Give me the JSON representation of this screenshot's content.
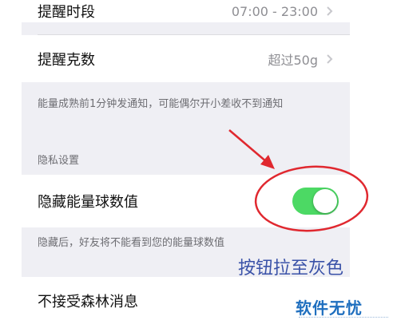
{
  "settings": {
    "remind_period": {
      "label": "提醒时段",
      "value": "07:00 - 23:00"
    },
    "remind_weight": {
      "label": "提醒克数",
      "value": "超过50g"
    },
    "remind_note": "能量成熟前1分钟发通知，可能偶尔开小差收不到通知",
    "privacy_section_title": "隐私设置",
    "hide_energy": {
      "label": "隐藏能量球数值",
      "enabled": true
    },
    "hide_note": "隐藏后，好友将不能看到您的能量球数值",
    "no_forest_msg": {
      "label": "不接受森林消息"
    }
  },
  "annotation": {
    "text": "按钮拉至灰色",
    "color": "#3a52a8",
    "mark_color": "#e0282f"
  },
  "watermark": {
    "text": "软件无忧"
  },
  "colors": {
    "toggle_on": "#4cd964",
    "background": "#efeff4",
    "secondary_text": "#8e8e93"
  }
}
